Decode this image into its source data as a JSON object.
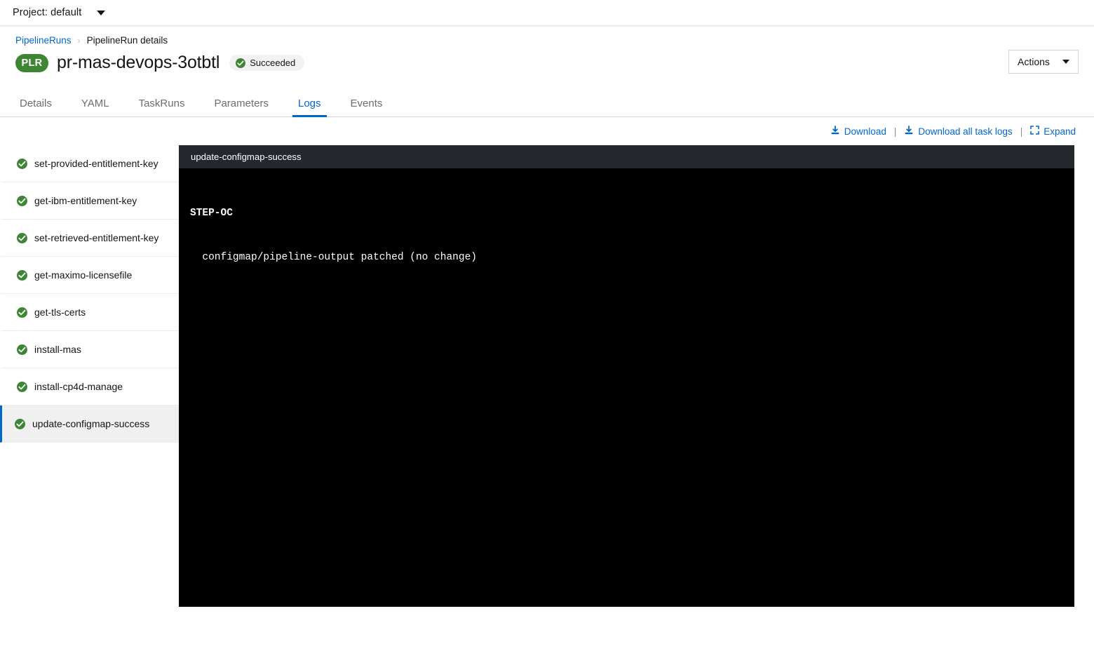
{
  "topbar": {
    "project_label": "Project: default",
    "dropdown_icon": "chevron-down-icon"
  },
  "breadcrumb": {
    "parent": "PipelineRuns",
    "separator": "›",
    "current": "PipelineRun details"
  },
  "header": {
    "kind_badge": "PLR",
    "title": "pr-mas-devops-3otbtl",
    "status": "Succeeded",
    "status_icon": "check-circle-icon",
    "status_color": "#3e8635",
    "actions_label": "Actions",
    "actions_icon": "caret-down-icon"
  },
  "tabs": [
    {
      "label": "Details",
      "active": false
    },
    {
      "label": "YAML",
      "active": false
    },
    {
      "label": "TaskRuns",
      "active": false
    },
    {
      "label": "Parameters",
      "active": false
    },
    {
      "label": "Logs",
      "active": true
    },
    {
      "label": "Events",
      "active": false
    }
  ],
  "log_toolbar": {
    "download": "Download",
    "download_icon": "download-icon",
    "download_all": "Download all task logs",
    "download_all_icon": "download-icon",
    "expand": "Expand",
    "expand_icon": "expand-icon",
    "separator": "|"
  },
  "task_list": [
    {
      "label": "set-provided-entitlement-key",
      "status_icon": "check-circle-icon",
      "selected": false
    },
    {
      "label": "get-ibm-entitlement-key",
      "status_icon": "check-circle-icon",
      "selected": false
    },
    {
      "label": "set-retrieved-entitlement-key",
      "status_icon": "check-circle-icon",
      "selected": false
    },
    {
      "label": "get-maximo-licensefile",
      "status_icon": "check-circle-icon",
      "selected": false
    },
    {
      "label": "get-tls-certs",
      "status_icon": "check-circle-icon",
      "selected": false
    },
    {
      "label": "install-mas",
      "status_icon": "check-circle-icon",
      "selected": false
    },
    {
      "label": "install-cp4d-manage",
      "status_icon": "check-circle-icon",
      "selected": false
    },
    {
      "label": "update-configmap-success",
      "status_icon": "check-circle-icon",
      "selected": true
    }
  ],
  "log_panel": {
    "header_title": "update-configmap-success",
    "step_label": "STEP-OC",
    "output_line": "  configmap/pipeline-output patched (no change)"
  },
  "colors": {
    "link_blue": "#0066cc",
    "success_green": "#3e8635",
    "log_header_bg": "#24282d",
    "log_bg": "#000000",
    "selected_row_bg": "#f0f0f0"
  }
}
